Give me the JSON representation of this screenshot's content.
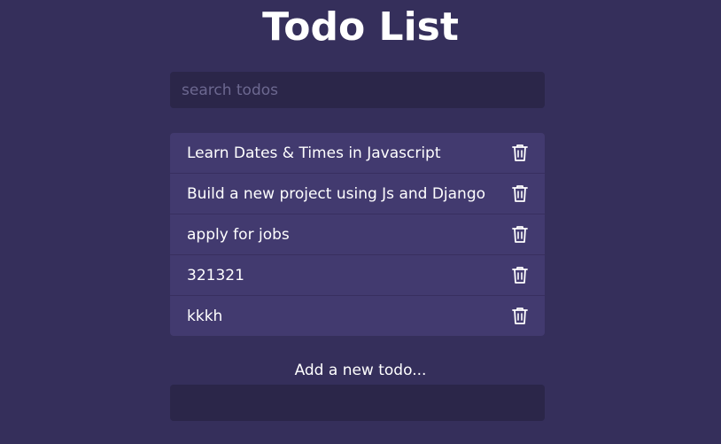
{
  "page": {
    "title": "Todo List"
  },
  "search": {
    "placeholder": "search todos",
    "value": ""
  },
  "todos": [
    {
      "text": "Learn Dates & Times in Javascript",
      "icon": "trash-icon"
    },
    {
      "text": "Build a new project using Js and Django",
      "icon": "trash-icon"
    },
    {
      "text": "apply for jobs",
      "icon": "trash-icon"
    },
    {
      "text": "321321",
      "icon": "trash-icon"
    },
    {
      "text": "kkkh",
      "icon": "trash-icon"
    }
  ],
  "add": {
    "label": "Add a new todo...",
    "value": ""
  },
  "colors": {
    "background": "#352f5b",
    "input_background": "#2b2649",
    "item_background": "#423a6f",
    "text": "#ffffff"
  }
}
